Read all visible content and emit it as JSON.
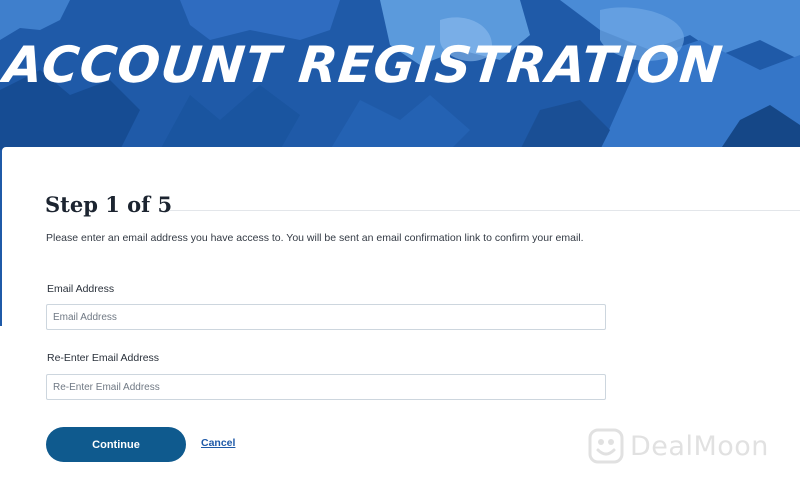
{
  "hero": {
    "title": "ACCOUNT REGISTRATION"
  },
  "form": {
    "step_title": "Step 1 of 5",
    "instructions": "Please enter an email address you have access to. You will be sent an email confirmation link to confirm your email.",
    "email": {
      "label": "Email Address",
      "placeholder": "Email Address",
      "value": ""
    },
    "confirm_email": {
      "label": "Re-Enter Email Address",
      "placeholder": "Re-Enter Email Address",
      "value": ""
    },
    "continue_label": "Continue",
    "cancel_label": "Cancel"
  },
  "watermark": {
    "text": "DealMoon"
  },
  "colors": {
    "hero_bg": "#1f5aa8",
    "button_bg": "#0f5a8e",
    "link": "#1f5aa8"
  }
}
